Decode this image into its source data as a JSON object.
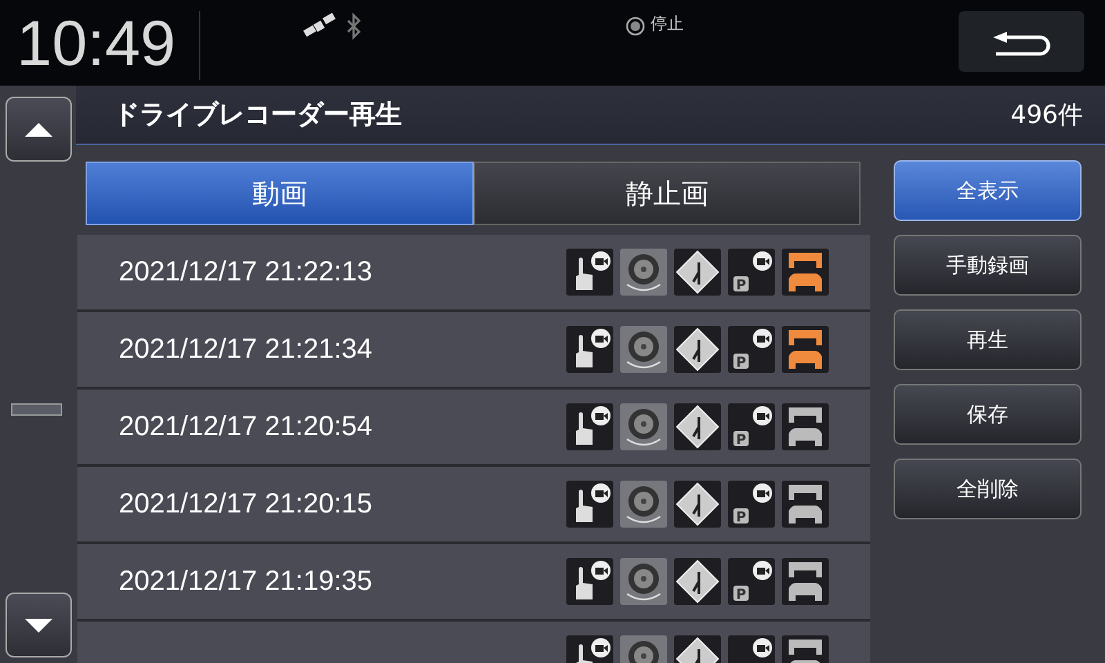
{
  "status_bar": {
    "clock": "10:49",
    "playback_state": "停止"
  },
  "header": {
    "title": "ドライブレコーダー再生",
    "count": "496件"
  },
  "tabs": [
    {
      "label": "動画",
      "selected": true
    },
    {
      "label": "静止画",
      "selected": false
    }
  ],
  "recordings": [
    {
      "datetime": "2021/12/17 21:22:13",
      "parking_label": "P",
      "car_icon_highlighted": true
    },
    {
      "datetime": "2021/12/17 21:21:34",
      "parking_label": "P",
      "car_icon_highlighted": true
    },
    {
      "datetime": "2021/12/17 21:20:54",
      "parking_label": "P",
      "car_icon_highlighted": false
    },
    {
      "datetime": "2021/12/17 21:20:15",
      "parking_label": "P",
      "car_icon_highlighted": false
    },
    {
      "datetime": "2021/12/17 21:19:35",
      "parking_label": "P",
      "car_icon_highlighted": false
    },
    {
      "car_icon_highlighted": false
    }
  ],
  "side_buttons": [
    {
      "label": "全表示",
      "selected": true
    },
    {
      "label": "手動録画",
      "selected": false
    },
    {
      "label": "再生",
      "selected": false
    },
    {
      "label": "保存",
      "selected": false
    },
    {
      "label": "全削除",
      "selected": false
    }
  ]
}
